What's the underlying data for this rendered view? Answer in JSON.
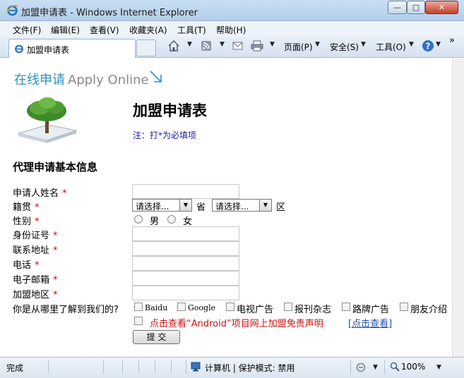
{
  "window": {
    "title": "加盟申请表 - Windows Internet Explorer",
    "min_glyph": "—",
    "max_glyph": "□",
    "close_glyph": "✕"
  },
  "menu": {
    "items": [
      "文件(F)",
      "编辑(E)",
      "查看(V)",
      "收藏夹(A)",
      "工具(T)",
      "帮助(H)"
    ]
  },
  "tab": {
    "label": "加盟申请表"
  },
  "command_bar": {
    "page": "页面(P)",
    "safety": "安全(S)",
    "tools": "工具(O)",
    "more": "»"
  },
  "page": {
    "header_cn": "在线申请",
    "header_en": "Apply Online",
    "form_title": "加盟申请表",
    "required_note": "注：打*为必填项",
    "section_title": "代理申请基本信息",
    "required_mark": "*",
    "fields": {
      "name": "申请人姓名",
      "native_place": "籍贯",
      "gender": "性别",
      "id_number": "身份证号",
      "address": "联系地址",
      "phone": "电话",
      "email": "电子邮箱",
      "region": "加盟地区",
      "source": "你是从哪里了解到我们的?"
    },
    "province_select": "请选择...",
    "province_suffix": "省",
    "district_select": "请选择...",
    "district_suffix": "区",
    "gender_options": [
      "男",
      "女"
    ],
    "source_options": [
      "Baidu",
      "Google",
      "电视广告",
      "报刊杂志",
      "路牌广告",
      "朋友介绍"
    ],
    "disclaimer": "点击查看“Android”项目网上加盟免责声明",
    "disclaimer_link": "[点击查看]",
    "submit": "提 交"
  },
  "status": {
    "text": "完成",
    "zone": "计算机 | 保护模式: 禁用",
    "zoom": "100%"
  }
}
